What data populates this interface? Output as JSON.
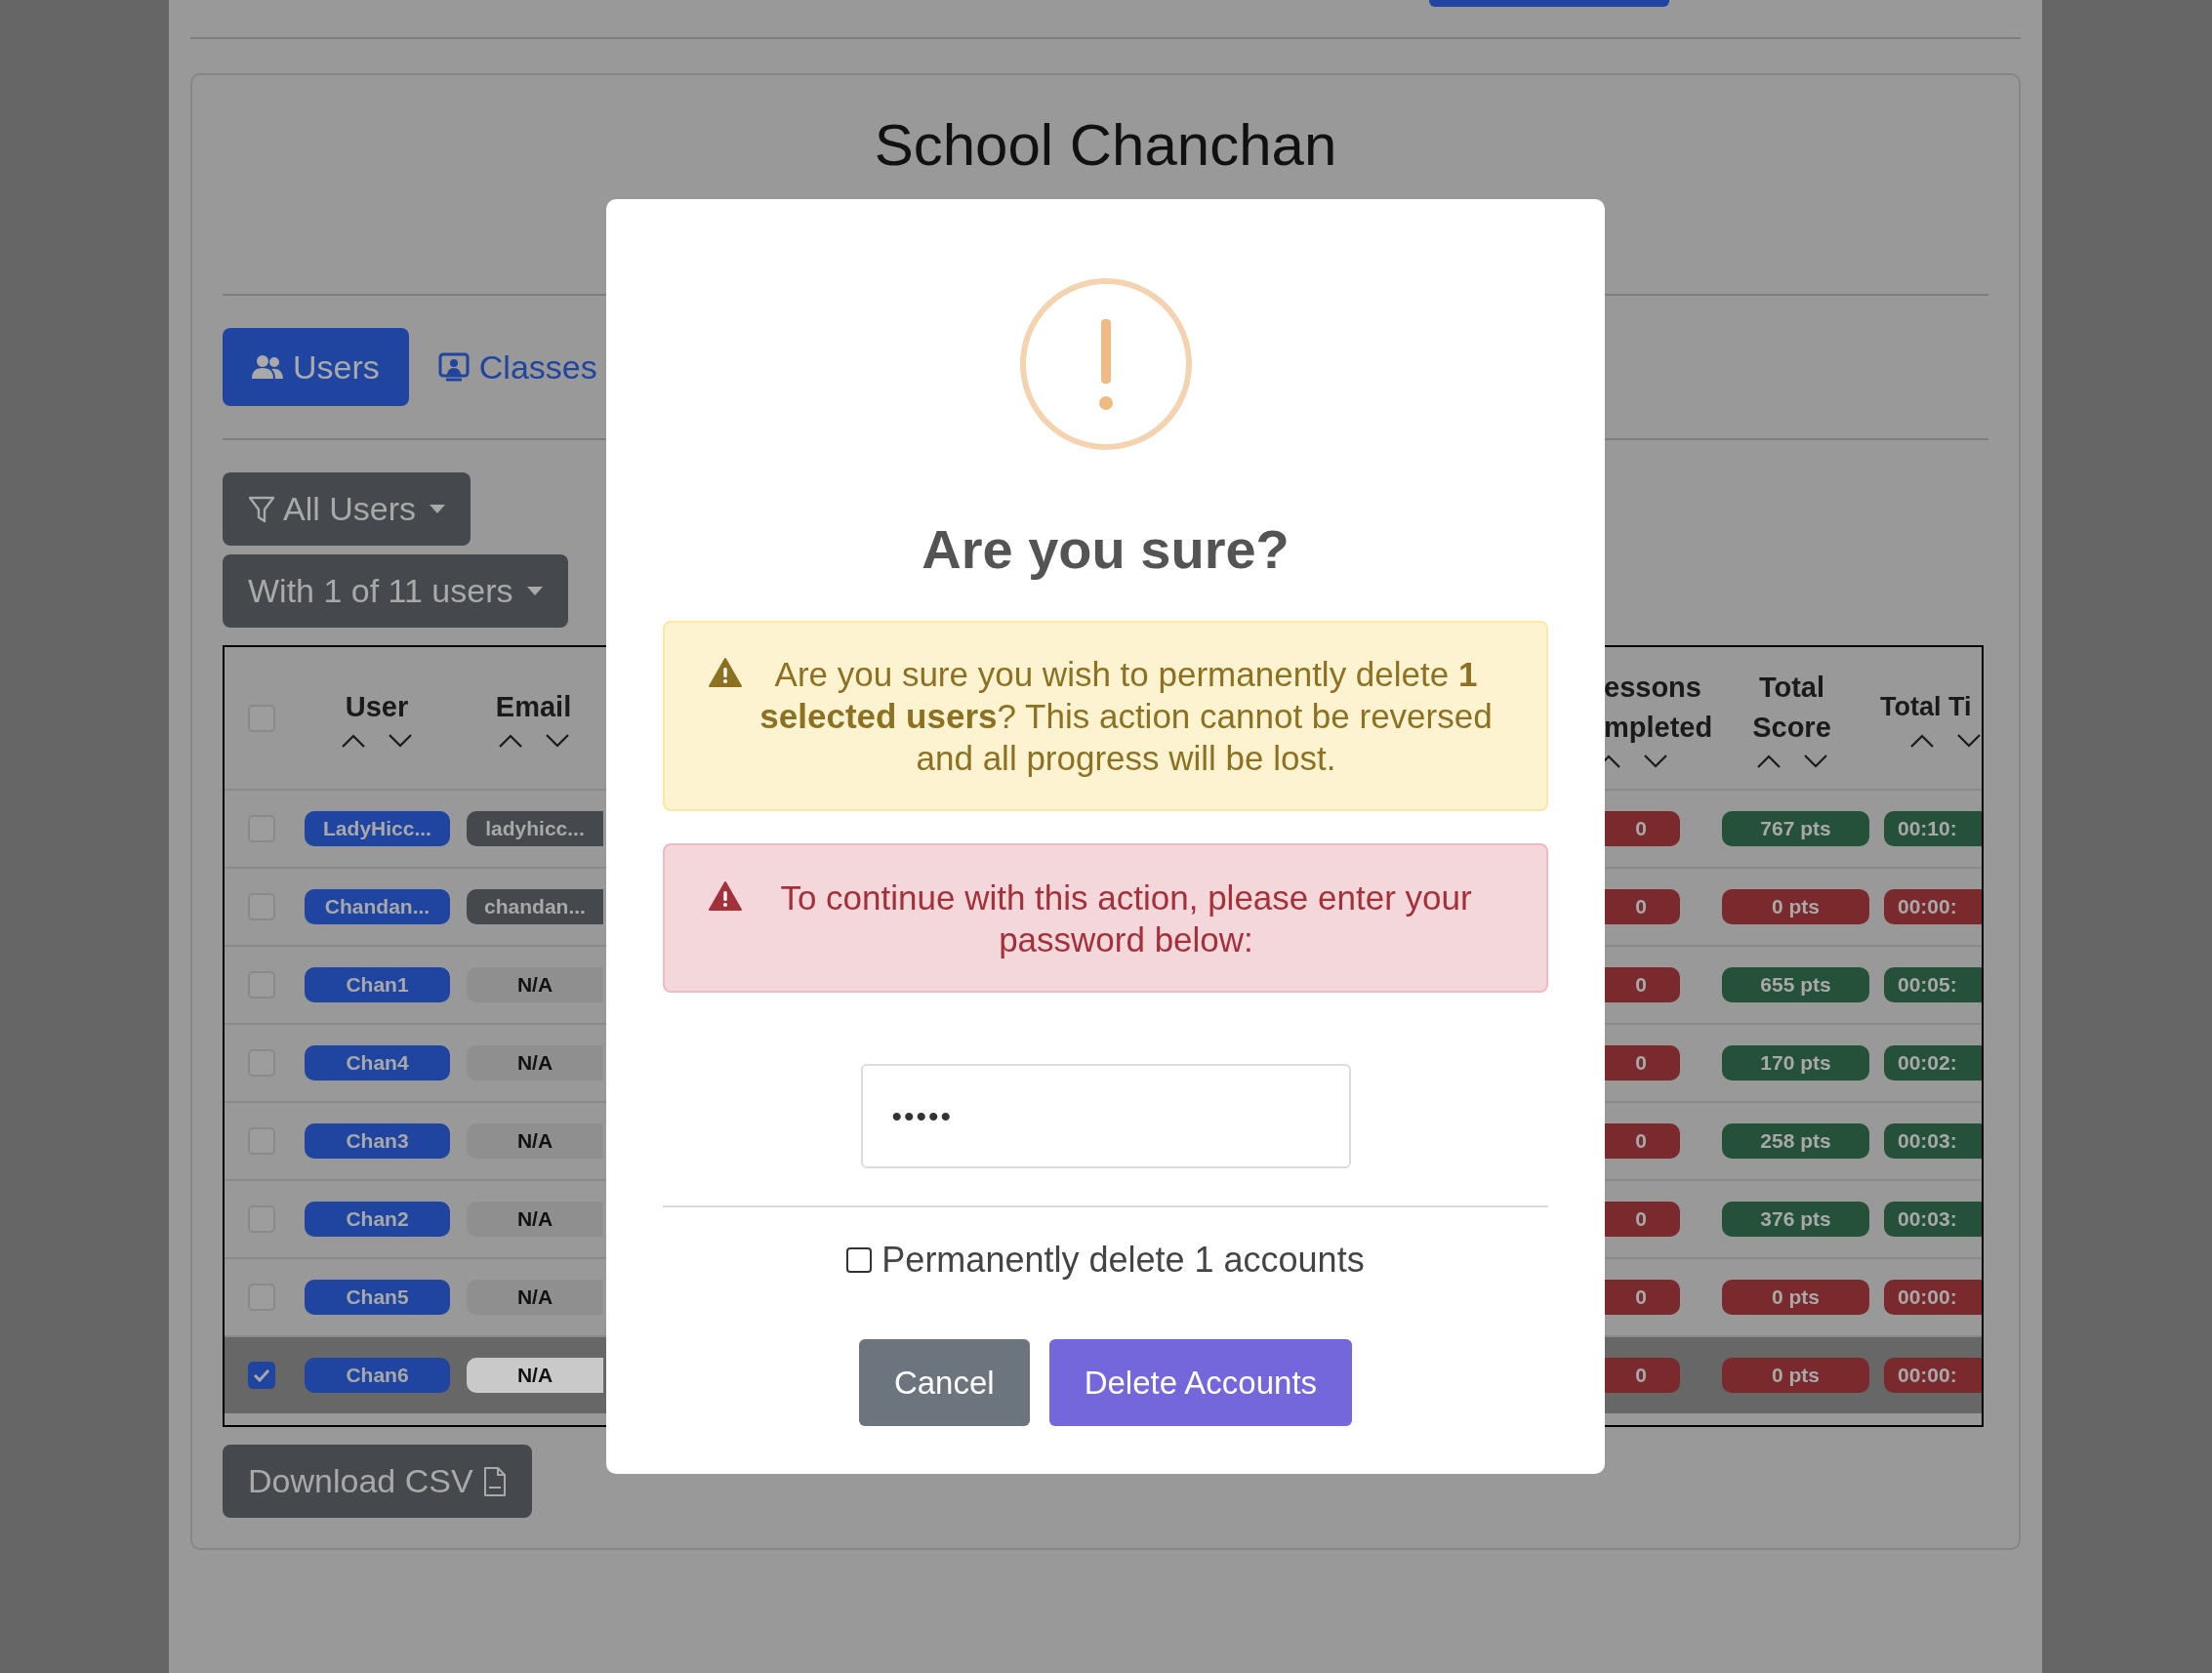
{
  "page": {
    "title": "School Chanchan"
  },
  "tabs": [
    {
      "label": "Users",
      "selected": true,
      "kind": "users"
    },
    {
      "label": "Classes",
      "selected": false,
      "kind": "classes"
    }
  ],
  "filters": [
    {
      "label": "All Users",
      "kind": "filter"
    },
    {
      "label": "With 1 of 11 users",
      "kind": "count"
    }
  ],
  "table": {
    "header_checked": false,
    "columns": [
      {
        "label": "User"
      },
      {
        "label": "Email"
      },
      {
        "label": "essons mpleted"
      },
      {
        "label": "Total Score"
      },
      {
        "label": "Total Ti"
      }
    ],
    "rows": [
      {
        "selected": false,
        "checked": false,
        "user": "LadyHicc...",
        "email": {
          "text": "ladyhicc...",
          "color": "#45484c"
        },
        "lessons": {
          "text": "0",
          "color": "#7a2a2d"
        },
        "score": {
          "text": "767 pts",
          "color": "#25513a"
        },
        "time": {
          "text": "00:10:",
          "color": "#25513a"
        }
      },
      {
        "selected": false,
        "checked": false,
        "user": "Chandan...",
        "email": {
          "text": "chandan...",
          "color": "#45484c"
        },
        "lessons": {
          "text": "0",
          "color": "#7a2a2d"
        },
        "score": {
          "text": "0 pts",
          "color": "#7a2a2d"
        },
        "time": {
          "text": "00:00:",
          "color": "#7a2a2d"
        }
      },
      {
        "selected": false,
        "checked": false,
        "user": "Chan1",
        "email": {
          "text": "N/A",
          "color": "#8f8f8f"
        },
        "lessons": {
          "text": "0",
          "color": "#7a2a2d"
        },
        "score": {
          "text": "655 pts",
          "color": "#25513a"
        },
        "time": {
          "text": "00:05:",
          "color": "#25513a"
        }
      },
      {
        "selected": false,
        "checked": false,
        "user": "Chan4",
        "email": {
          "text": "N/A",
          "color": "#8f8f8f"
        },
        "lessons": {
          "text": "0",
          "color": "#7a2a2d"
        },
        "score": {
          "text": "170 pts",
          "color": "#25513a"
        },
        "time": {
          "text": "00:02:",
          "color": "#25513a"
        }
      },
      {
        "selected": false,
        "checked": false,
        "user": "Chan3",
        "email": {
          "text": "N/A",
          "color": "#8f8f8f"
        },
        "lessons": {
          "text": "0",
          "color": "#7a2a2d"
        },
        "score": {
          "text": "258 pts",
          "color": "#25513a"
        },
        "time": {
          "text": "00:03:",
          "color": "#25513a"
        }
      },
      {
        "selected": false,
        "checked": false,
        "user": "Chan2",
        "email": {
          "text": "N/A",
          "color": "#8f8f8f"
        },
        "lessons": {
          "text": "0",
          "color": "#7a2a2d"
        },
        "score": {
          "text": "376 pts",
          "color": "#25513a"
        },
        "time": {
          "text": "00:03:",
          "color": "#25513a"
        }
      },
      {
        "selected": false,
        "checked": false,
        "user": "Chan5",
        "email": {
          "text": "N/A",
          "color": "#8f8f8f"
        },
        "lessons": {
          "text": "0",
          "color": "#7a2a2d"
        },
        "score": {
          "text": "0 pts",
          "color": "#7a2a2d"
        },
        "time": {
          "text": "00:00:",
          "color": "#7a2a2d"
        }
      },
      {
        "selected": true,
        "checked": true,
        "user": "Chan6",
        "email": {
          "text": "N/A",
          "color": "#c9c9c9"
        },
        "lessons": {
          "text": "0",
          "color": "#7a2a2d"
        },
        "score": {
          "text": "0 pts",
          "color": "#7a2a2d"
        },
        "time": {
          "text": "00:00:",
          "color": "#7a2a2d"
        }
      }
    ]
  },
  "download_button": "Download CSV",
  "modal": {
    "title": "Are you sure?",
    "warning": "Are you sure you wish to permanently delete **1 selected users**? This action cannot be reversed and all progress will be lost.",
    "error": "To continue with this action, please enter your password below:",
    "password": {
      "value": "•••••"
    },
    "confirm": {
      "label": "Permanently delete 1 accounts",
      "checked": false
    },
    "buttons": [
      {
        "label": "Cancel",
        "kind": "secondary"
      },
      {
        "label": "Delete Accounts",
        "kind": "primary"
      }
    ]
  }
}
